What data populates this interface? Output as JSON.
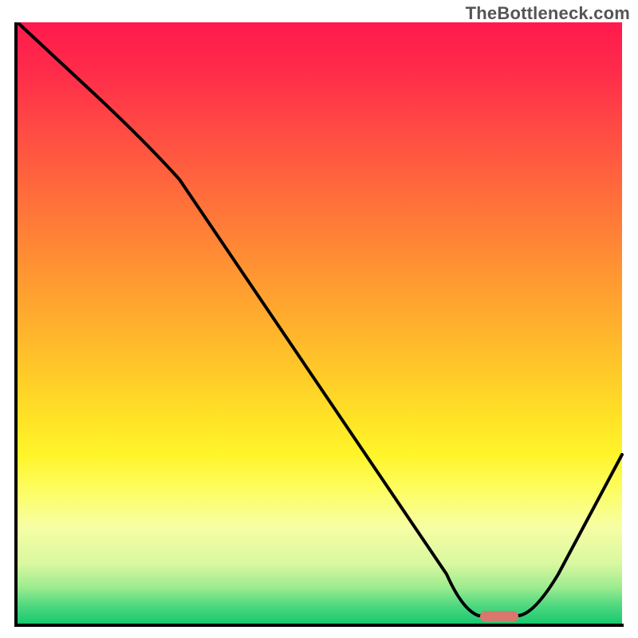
{
  "watermark": "TheBottleneck.com",
  "colors": {
    "axis": "#000000",
    "curve": "#000000",
    "marker": "#d9776f",
    "watermark_text": "#555555"
  },
  "chart_data": {
    "type": "line",
    "title": "",
    "xlabel": "",
    "ylabel": "",
    "xlim": [
      0,
      100
    ],
    "ylim": [
      0,
      100
    ],
    "background_gradient": {
      "direction": "vertical",
      "stops": [
        {
          "pos": 0,
          "color": "#ff1a4d"
        },
        {
          "pos": 50,
          "color": "#ffbb2a"
        },
        {
          "pos": 75,
          "color": "#fff52a"
        },
        {
          "pos": 100,
          "color": "#19c96f"
        }
      ]
    },
    "x": [
      0,
      10,
      20,
      30,
      40,
      50,
      60,
      70,
      74,
      78,
      82,
      90,
      100
    ],
    "values": [
      100,
      92,
      84,
      73,
      59,
      45,
      30,
      10,
      1,
      0,
      0,
      12,
      32
    ],
    "minimum_region": {
      "x_start": 76,
      "x_end": 82,
      "y": 0
    },
    "legend": false,
    "grid": false
  }
}
